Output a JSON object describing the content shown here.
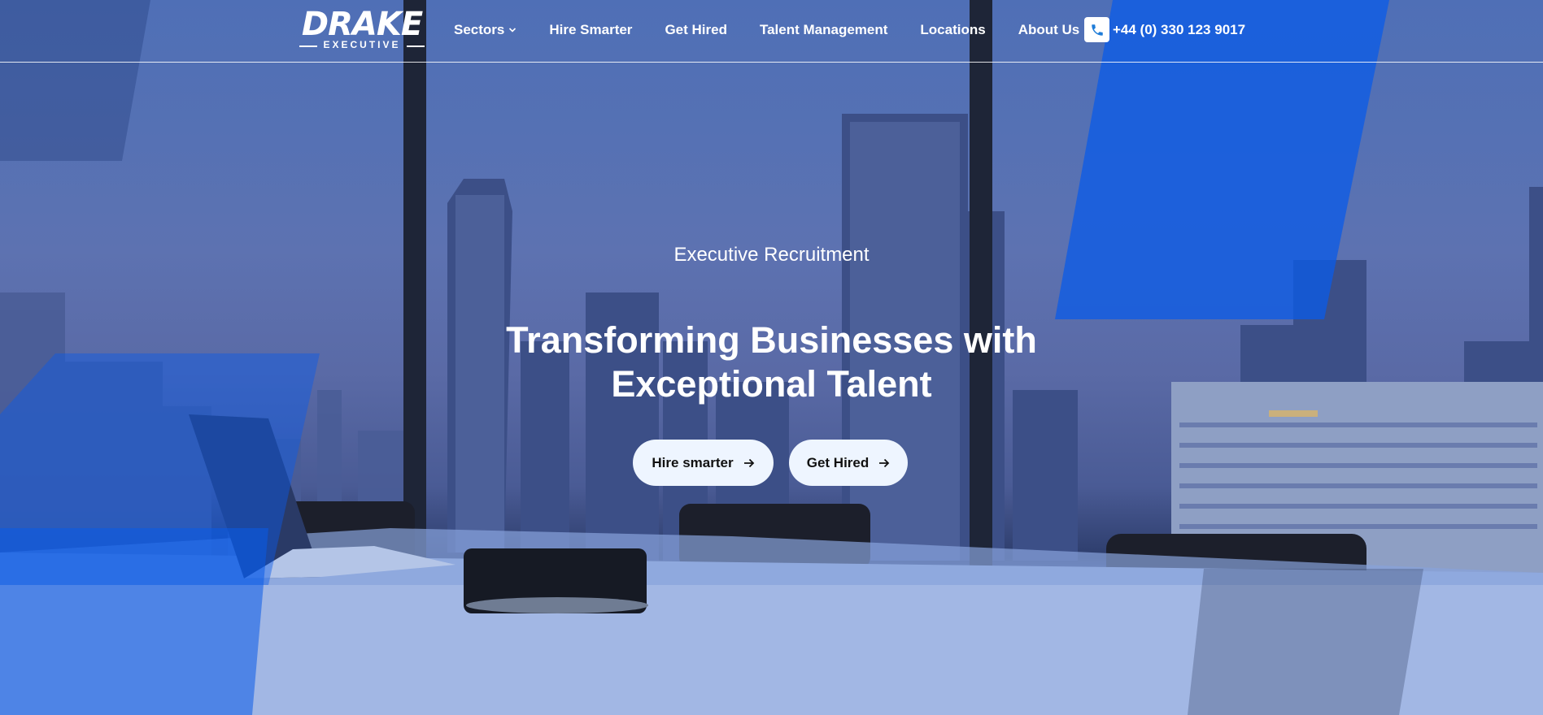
{
  "brand": {
    "name": "DRAKE",
    "subtitle": "EXECUTIVE"
  },
  "nav": {
    "items": [
      {
        "label": "Sectors",
        "has_dropdown": true
      },
      {
        "label": "Hire Smarter"
      },
      {
        "label": "Get Hired"
      },
      {
        "label": "Talent Management"
      },
      {
        "label": "Locations"
      },
      {
        "label": "About Us"
      }
    ],
    "phone": "+44 (0) 330 123 9017"
  },
  "hero": {
    "eyebrow": "Executive Recruitment",
    "headline_line1": "Transforming Businesses with",
    "headline_line2": "Exceptional Talent",
    "cta_primary": "Hire smarter",
    "cta_secondary": "Get Hired"
  },
  "colors": {
    "accent": "#1e7cd8",
    "overlay_blue": "#0a5be8",
    "button_bg": "#eef5ff",
    "text": "#ffffff"
  },
  "icons": {
    "phone": "phone-icon",
    "chevron": "chevron-down-icon",
    "arrow": "arrow-right-icon"
  }
}
